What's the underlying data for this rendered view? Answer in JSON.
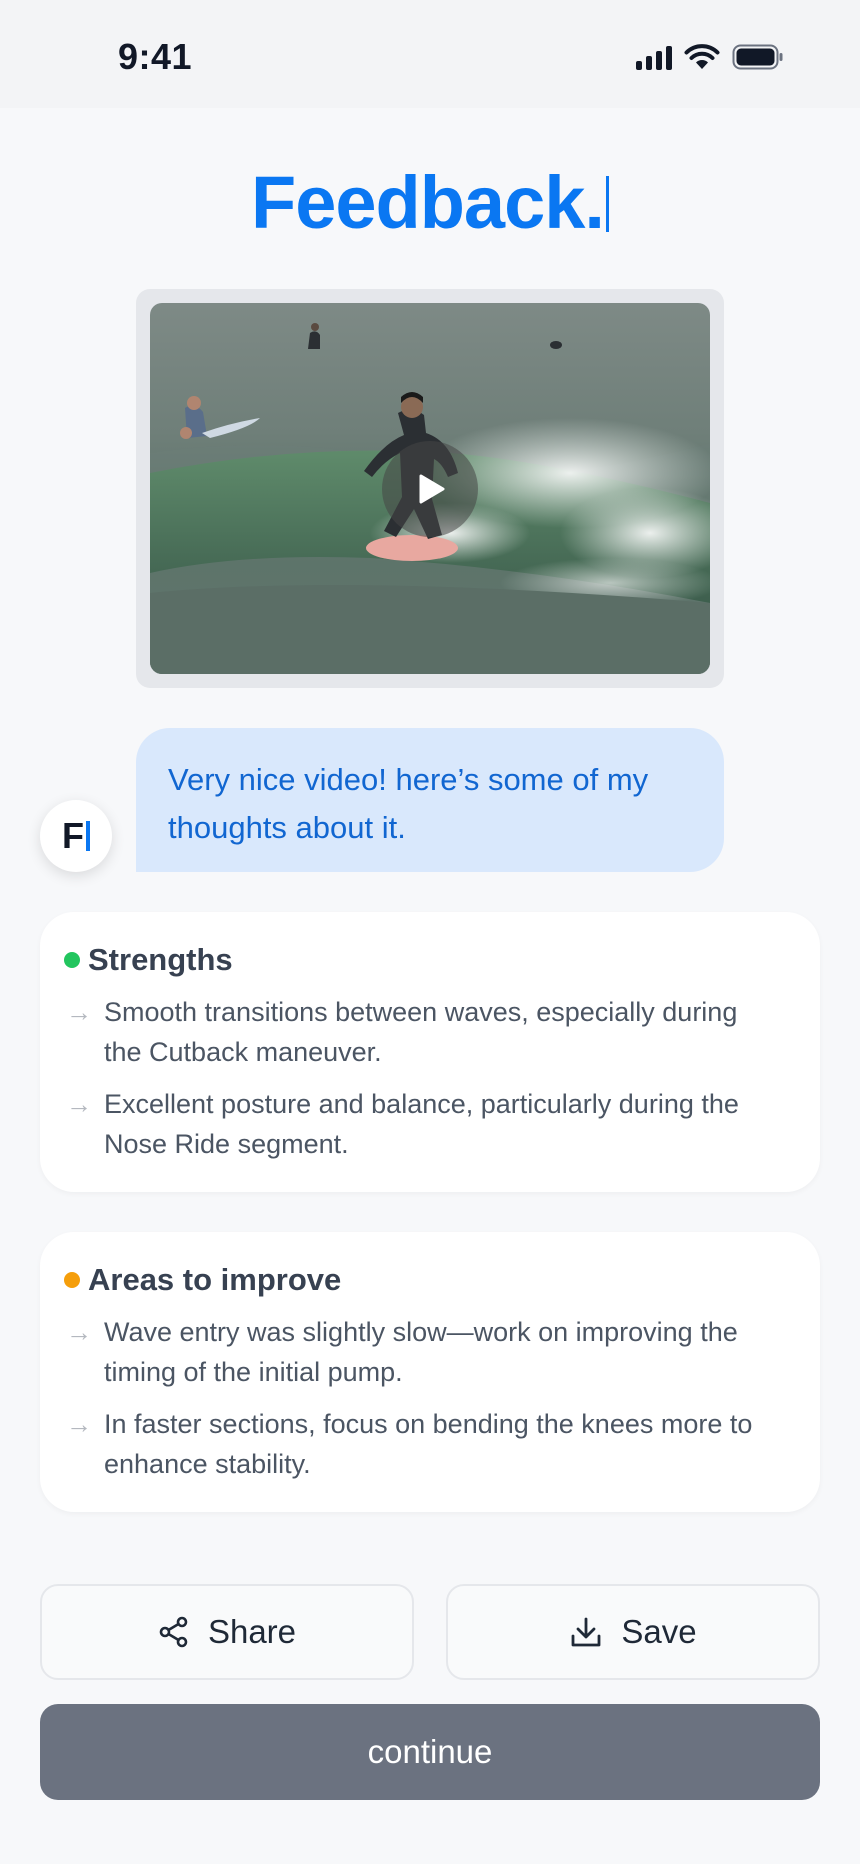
{
  "status_bar": {
    "time": "9:41"
  },
  "header": {
    "title": "Feedback."
  },
  "video": {
    "has_play_button": true
  },
  "chat": {
    "avatar_letter": "F",
    "message": "Very nice video! here’s some of my thoughts about it."
  },
  "strengths": {
    "heading": "Strengths",
    "color": "#22c55e",
    "items": [
      "Smooth transitions between waves, especially during the Cutback maneuver.",
      "Excellent posture and balance, particularly during the Nose Ride segment."
    ]
  },
  "improve": {
    "heading": "Areas to improve",
    "color": "#f59e0b",
    "items": [
      "Wave entry was slightly slow—work on improving the timing of the initial pump.",
      "In faster sections, focus on bending the knees more to enhance stability."
    ]
  },
  "actions": {
    "share_label": "Share",
    "save_label": "Save",
    "continue_label": "continue"
  },
  "colors": {
    "accent": "#0a77f2",
    "bubble": "#d9e8fc",
    "continue_bg": "#6b7280"
  },
  "icons": [
    "signal-icon",
    "wifi-icon",
    "battery-icon",
    "play-icon",
    "arrow-right-icon",
    "share-icon",
    "download-icon"
  ]
}
